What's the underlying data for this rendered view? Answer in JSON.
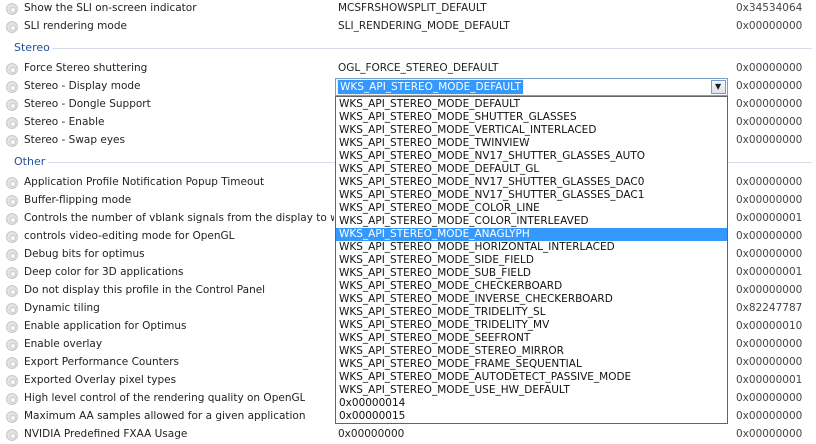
{
  "top_rows": [
    {
      "name": "Show the SLI on-screen indicator",
      "value": "MCSFRSHOWSPLIT_DEFAULT",
      "hex": "0x34534064"
    },
    {
      "name": "SLI rendering mode",
      "value": "SLI_RENDERING_MODE_DEFAULT",
      "hex": "0x00000000"
    }
  ],
  "stereo_section": {
    "title": "Stereo",
    "rows": [
      {
        "name": "Force Stereo shuttering",
        "value": "OGL_FORCE_STEREO_DEFAULT",
        "hex": "0x00000000"
      },
      {
        "name": "Stereo - Display mode",
        "value": "",
        "hex": "0x00000000"
      },
      {
        "name": "Stereo - Dongle Support",
        "value": "",
        "hex": "0x00000000"
      },
      {
        "name": "Stereo - Enable",
        "value": "",
        "hex": "0x00000000"
      },
      {
        "name": "Stereo - Swap eyes",
        "value": "",
        "hex": "0x00000000"
      }
    ]
  },
  "other_section": {
    "title": "Other",
    "rows": [
      {
        "name": "Application Profile Notification Popup Timeout",
        "value": "",
        "hex": "0x00000000"
      },
      {
        "name": "Buffer-flipping mode",
        "value": "",
        "hex": "0x00000000"
      },
      {
        "name": "Controls the number of vblank signals from the display to wait b...",
        "value": "",
        "hex": "0x00000001"
      },
      {
        "name": "controls video-editing mode for OpenGL",
        "value": "",
        "hex": "0x00000000"
      },
      {
        "name": "Debug bits for optimus",
        "value": "",
        "hex": "0x00000000"
      },
      {
        "name": "Deep color for 3D applications",
        "value": "",
        "hex": "0x00000001"
      },
      {
        "name": "Do not display this profile in the Control Panel",
        "value": "",
        "hex": "0x00000000"
      },
      {
        "name": "Dynamic tiling",
        "value": "",
        "hex": "0x82247787"
      },
      {
        "name": "Enable application for Optimus",
        "value": "",
        "hex": "0x00000010"
      },
      {
        "name": "Enable overlay",
        "value": "",
        "hex": "0x00000000"
      },
      {
        "name": "Export Performance Counters",
        "value": "",
        "hex": "0x00000000"
      },
      {
        "name": "Exported Overlay pixel types",
        "value": "",
        "hex": "0x00000001"
      },
      {
        "name": "High level control of the rendering quality on OpenGL",
        "value": "",
        "hex": "0x00000000"
      },
      {
        "name": "Maximum AA samples allowed for a given application",
        "value": "",
        "hex": "0x00000000"
      },
      {
        "name": "NVIDIA Predefined FXAA Usage",
        "value": "0x00000000",
        "hex": "0x00000000"
      }
    ]
  },
  "combo": {
    "selected": "WKS_API_STEREO_MODE_DEFAULT",
    "arrow_icon": "chevron-down-icon",
    "highlight_color": "#3399ff",
    "highlighted_index": 10
  },
  "dropdown_options": [
    "WKS_API_STEREO_MODE_DEFAULT",
    "WKS_API_STEREO_MODE_SHUTTER_GLASSES",
    "WKS_API_STEREO_MODE_VERTICAL_INTERLACED",
    "WKS_API_STEREO_MODE_TWINVIEW",
    "WKS_API_STEREO_MODE_NV17_SHUTTER_GLASSES_AUTO",
    "WKS_API_STEREO_MODE_DEFAULT_GL",
    "WKS_API_STEREO_MODE_NV17_SHUTTER_GLASSES_DAC0",
    "WKS_API_STEREO_MODE_NV17_SHUTTER_GLASSES_DAC1",
    "WKS_API_STEREO_MODE_COLOR_LINE",
    "WKS_API_STEREO_MODE_COLOR_INTERLEAVED",
    "WKS_API_STEREO_MODE_ANAGLYPH",
    "WKS_API_STEREO_MODE_HORIZONTAL_INTERLACED",
    "WKS_API_STEREO_MODE_SIDE_FIELD",
    "WKS_API_STEREO_MODE_SUB_FIELD",
    "WKS_API_STEREO_MODE_CHECKERBOARD",
    "WKS_API_STEREO_MODE_INVERSE_CHECKERBOARD",
    "WKS_API_STEREO_MODE_TRIDELITY_SL",
    "WKS_API_STEREO_MODE_TRIDELITY_MV",
    "WKS_API_STEREO_MODE_SEEFRONT",
    "WKS_API_STEREO_MODE_STEREO_MIRROR",
    "WKS_API_STEREO_MODE_FRAME_SEQUENTIAL",
    "WKS_API_STEREO_MODE_AUTODETECT_PASSIVE_MODE",
    "WKS_API_STEREO_MODE_USE_HW_DEFAULT",
    "0x00000014",
    "0x00000015"
  ]
}
